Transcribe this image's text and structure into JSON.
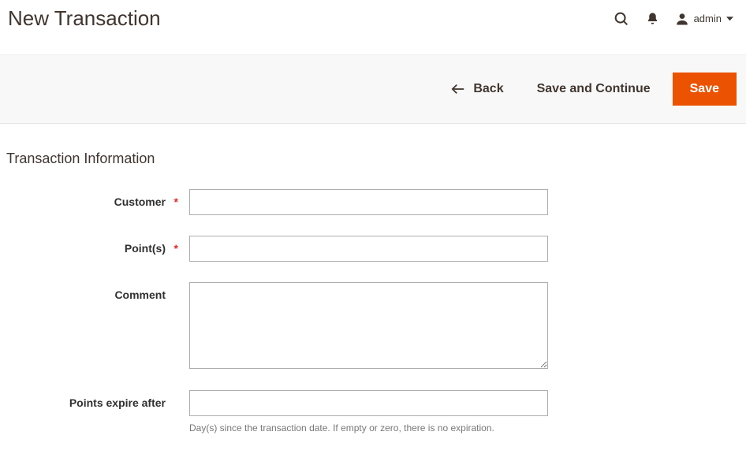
{
  "header": {
    "title": "New Transaction",
    "user_label": "admin"
  },
  "actions": {
    "back": "Back",
    "save_continue": "Save and Continue",
    "save": "Save"
  },
  "section": {
    "title": "Transaction Information"
  },
  "fields": {
    "customer": {
      "label": "Customer",
      "value": ""
    },
    "points": {
      "label": "Point(s)",
      "value": ""
    },
    "comment": {
      "label": "Comment",
      "value": ""
    },
    "expire": {
      "label": "Points expire after",
      "value": "",
      "note": "Day(s) since the transaction date. If empty or zero, there is no expiration."
    }
  }
}
